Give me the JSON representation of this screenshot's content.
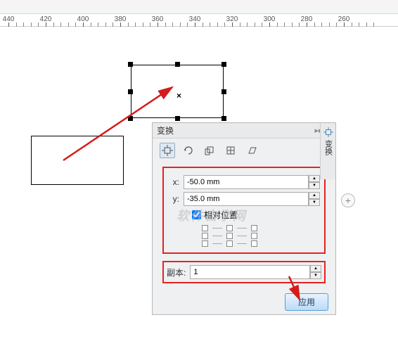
{
  "ruler": {
    "ticks": [
      440,
      420,
      400,
      380,
      360,
      340,
      320,
      300,
      280,
      260
    ]
  },
  "panel": {
    "title": "变换",
    "collapse_glyph": "▸▸",
    "close_glyph": "×",
    "x_label": "x:",
    "y_label": "y:",
    "x_value": "-50.0 mm",
    "y_value": "-35.0 mm",
    "relative_label": "相对位置",
    "relative_checked": true,
    "copy_label": "副本:",
    "copy_value": "1",
    "apply_label": "应用",
    "side_tab_label": "变换"
  },
  "watermark": "软件自学网",
  "colors": {
    "highlight": "#e62222",
    "arrow": "#d41c1c"
  }
}
